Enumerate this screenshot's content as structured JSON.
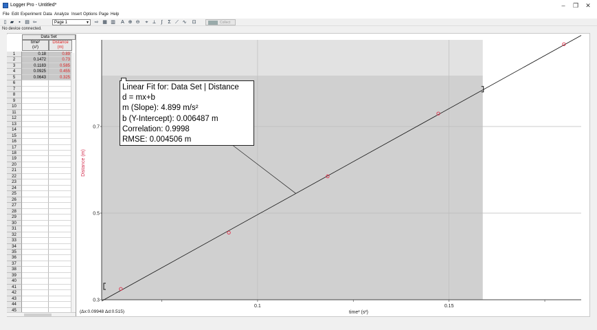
{
  "window": {
    "title": "Logger Pro - Untitled*",
    "minimize": "–",
    "maximize": "❐",
    "close": "✕"
  },
  "menu": [
    "File",
    "Edit",
    "Experiment",
    "Data",
    "Analyze",
    "Insert",
    "Options",
    "Page",
    "Help"
  ],
  "toolbar": {
    "page_label": "Page 1",
    "collect_label": "Collect"
  },
  "status": "No device connected.",
  "table": {
    "dataset_title": "Data Set",
    "col1": {
      "name": "time²",
      "unit": "(s²)"
    },
    "col2": {
      "name": "Distance",
      "unit": "(m)"
    },
    "rows": [
      [
        "0.18",
        "0.89"
      ],
      [
        "0.1472",
        "0.73"
      ],
      [
        "0.1183",
        "0.585"
      ],
      [
        "0.0925",
        "0.455"
      ],
      [
        "0.0643",
        "0.325"
      ]
    ],
    "row_count": 45
  },
  "fit": {
    "title": "Linear Fit for: Data Set | Distance",
    "equation": "d = mx+b",
    "slope": "m (Slope): 4.899 m/s²",
    "intercept": "b (Y-Intercept): 0.006487 m",
    "correlation": "Correlation: 0.9998",
    "rmse": "RMSE: 0.004506 m"
  },
  "delta_readout": "(Δx:0.09948 Δd:0.515)",
  "colors": {
    "data_point": "#e0304a",
    "ylabel": "#d32f4f",
    "shade": "#d0d0d0",
    "shade_light": "#e2e2e2"
  },
  "chart_data": {
    "type": "scatter",
    "xlabel": "time² (s²)",
    "ylabel": "Distance (m)",
    "x": [
      0.18,
      0.1472,
      0.1183,
      0.0925,
      0.0643
    ],
    "y": [
      0.89,
      0.73,
      0.585,
      0.455,
      0.325
    ],
    "xlim": [
      0.0593,
      0.1845
    ],
    "ylim": [
      0.3,
      0.9
    ],
    "x_ticks": [
      0.1,
      0.15
    ],
    "y_ticks": [
      0.3,
      0.5,
      0.7
    ],
    "fit_line": {
      "slope": 4.899,
      "intercept": 0.006487
    },
    "selection_x": [
      0.0593,
      0.1588
    ],
    "grid": true
  }
}
